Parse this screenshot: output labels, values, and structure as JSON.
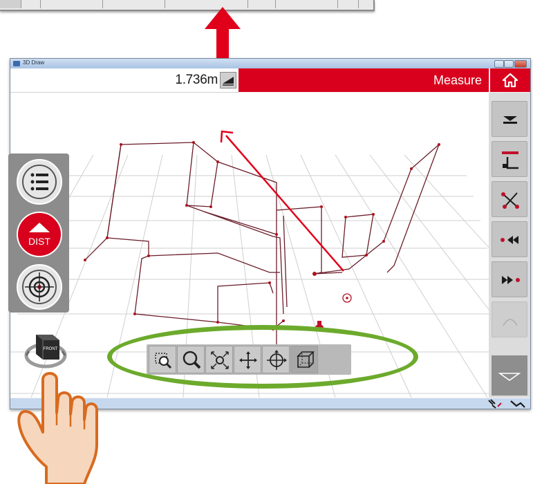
{
  "window": {
    "title": "3D Draw"
  },
  "toolbar": {
    "distance_value": "1.736m",
    "mode_label": "Measure"
  },
  "left_palette": {
    "dist_label": "DIST"
  },
  "view_cube": {
    "label": "FRONT"
  },
  "icons": {
    "home": "home-icon",
    "menu": "list-menu-icon",
    "dist": "dist-up-arrow-icon",
    "target": "target-icon",
    "zoom_window": "zoom-window-icon",
    "zoom": "zoom-magnifier-icon",
    "zoom_extents": "zoom-extents-icon",
    "pan": "pan-arrows-icon",
    "orbit": "orbit-icon",
    "box_view": "box-view-icon"
  },
  "colors": {
    "accent_red": "#d8001c",
    "highlight_green": "#6caa2c",
    "arrow_red": "#e0001a"
  }
}
